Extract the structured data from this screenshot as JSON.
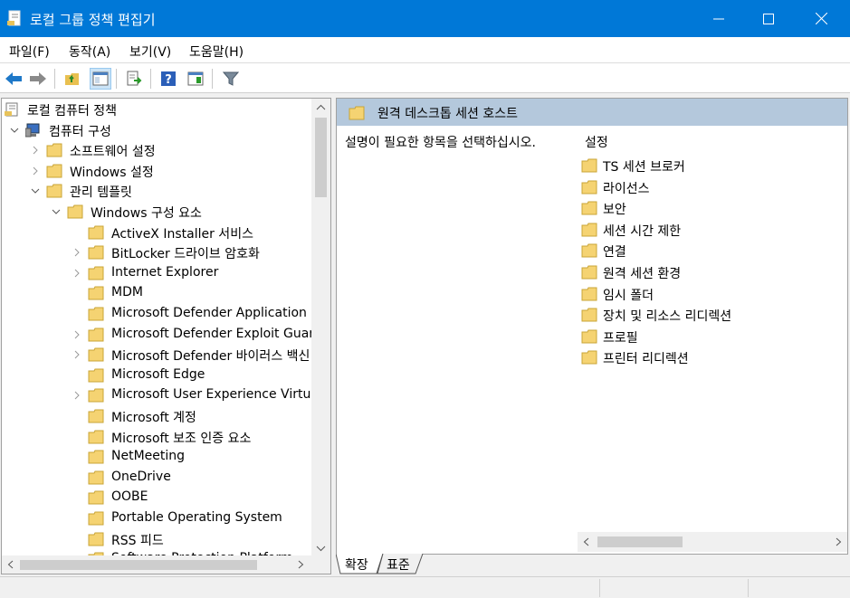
{
  "window": {
    "title": "로컬 그룹 정책 편집기"
  },
  "menu": [
    "파일(F)",
    "동작(A)",
    "보기(V)",
    "도움말(H)"
  ],
  "toolbar": {
    "buttons": [
      "back-icon",
      "forward-icon",
      "up-folder-icon",
      "show-tree-icon",
      "export-list-icon",
      "help-icon",
      "properties-view-icon",
      "filter-icon"
    ]
  },
  "tree": {
    "items": [
      {
        "label": "로컬 컴퓨터 정책",
        "icon": "policy-document-icon",
        "expander": ""
      },
      {
        "label": "컴퓨터 구성",
        "icon": "computer-icon",
        "expander": "expanded"
      },
      {
        "label": "소프트웨어 설정",
        "icon": "folder-icon",
        "expander": "collapsed"
      },
      {
        "label": "Windows 설정",
        "icon": "folder-icon",
        "expander": "collapsed"
      },
      {
        "label": "관리 템플릿",
        "icon": "folder-icon",
        "expander": "expanded"
      },
      {
        "label": "Windows 구성 요소",
        "icon": "folder-icon",
        "expander": "expanded"
      },
      {
        "label": "ActiveX Installer 서비스",
        "icon": "folder-icon",
        "expander": ""
      },
      {
        "label": "BitLocker 드라이브 암호화",
        "icon": "folder-icon",
        "expander": "collapsed"
      },
      {
        "label": "Internet Explorer",
        "icon": "folder-icon",
        "expander": "collapsed"
      },
      {
        "label": "MDM",
        "icon": "folder-icon",
        "expander": ""
      },
      {
        "label": "Microsoft Defender Application G",
        "icon": "folder-icon",
        "expander": ""
      },
      {
        "label": "Microsoft Defender Exploit Guard",
        "icon": "folder-icon",
        "expander": "collapsed"
      },
      {
        "label": "Microsoft Defender 바이러스 백신",
        "icon": "folder-icon",
        "expander": "collapsed"
      },
      {
        "label": "Microsoft Edge",
        "icon": "folder-icon",
        "expander": ""
      },
      {
        "label": "Microsoft User Experience Virtual",
        "icon": "folder-icon",
        "expander": "collapsed"
      },
      {
        "label": "Microsoft 계정",
        "icon": "folder-icon",
        "expander": ""
      },
      {
        "label": "Microsoft 보조 인증 요소",
        "icon": "folder-icon",
        "expander": ""
      },
      {
        "label": "NetMeeting",
        "icon": "folder-icon",
        "expander": ""
      },
      {
        "label": "OneDrive",
        "icon": "folder-icon",
        "expander": ""
      },
      {
        "label": "OOBE",
        "icon": "folder-icon",
        "expander": ""
      },
      {
        "label": "Portable Operating System",
        "icon": "folder-icon",
        "expander": ""
      },
      {
        "label": "RSS 피드",
        "icon": "folder-icon",
        "expander": ""
      },
      {
        "label": "Software Protection Platform",
        "icon": "folder-icon",
        "expander": ""
      }
    ]
  },
  "details": {
    "header_title": "원격 데스크톱 세션 호스트",
    "description": "설명이 필요한 항목을 선택하십시오.",
    "column_header": "설정",
    "items": [
      "TS 세션 브로커",
      "라이선스",
      "보안",
      "세션 시간 제한",
      "연결",
      "원격 세션 환경",
      "임시 폴더",
      "장치 및 리소스 리디렉션",
      "프로필",
      "프린터 리디렉션"
    ]
  },
  "bottom_tabs": [
    "확장",
    "표준"
  ],
  "colors": {
    "titlebar": "#0078d7",
    "header_band": "#b4c8dc",
    "folder": "#f5d372"
  }
}
